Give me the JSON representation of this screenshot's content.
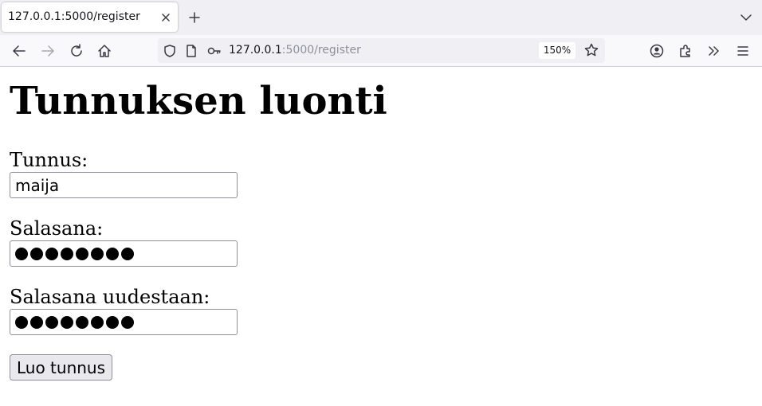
{
  "browser": {
    "tab_title": "127.0.0.1:5000/register",
    "url_host": "127.0.0.1",
    "url_path": ":5000/register",
    "zoom": "150%"
  },
  "page": {
    "heading": "Tunnuksen luonti",
    "form": {
      "username_label": "Tunnus:",
      "username_value": "maija",
      "password_label": "Salasana:",
      "password_masked_length": 8,
      "password_confirm_label": "Salasana uudestaan:",
      "password_confirm_masked_length": 8,
      "submit_label": "Luo tunnus"
    }
  }
}
